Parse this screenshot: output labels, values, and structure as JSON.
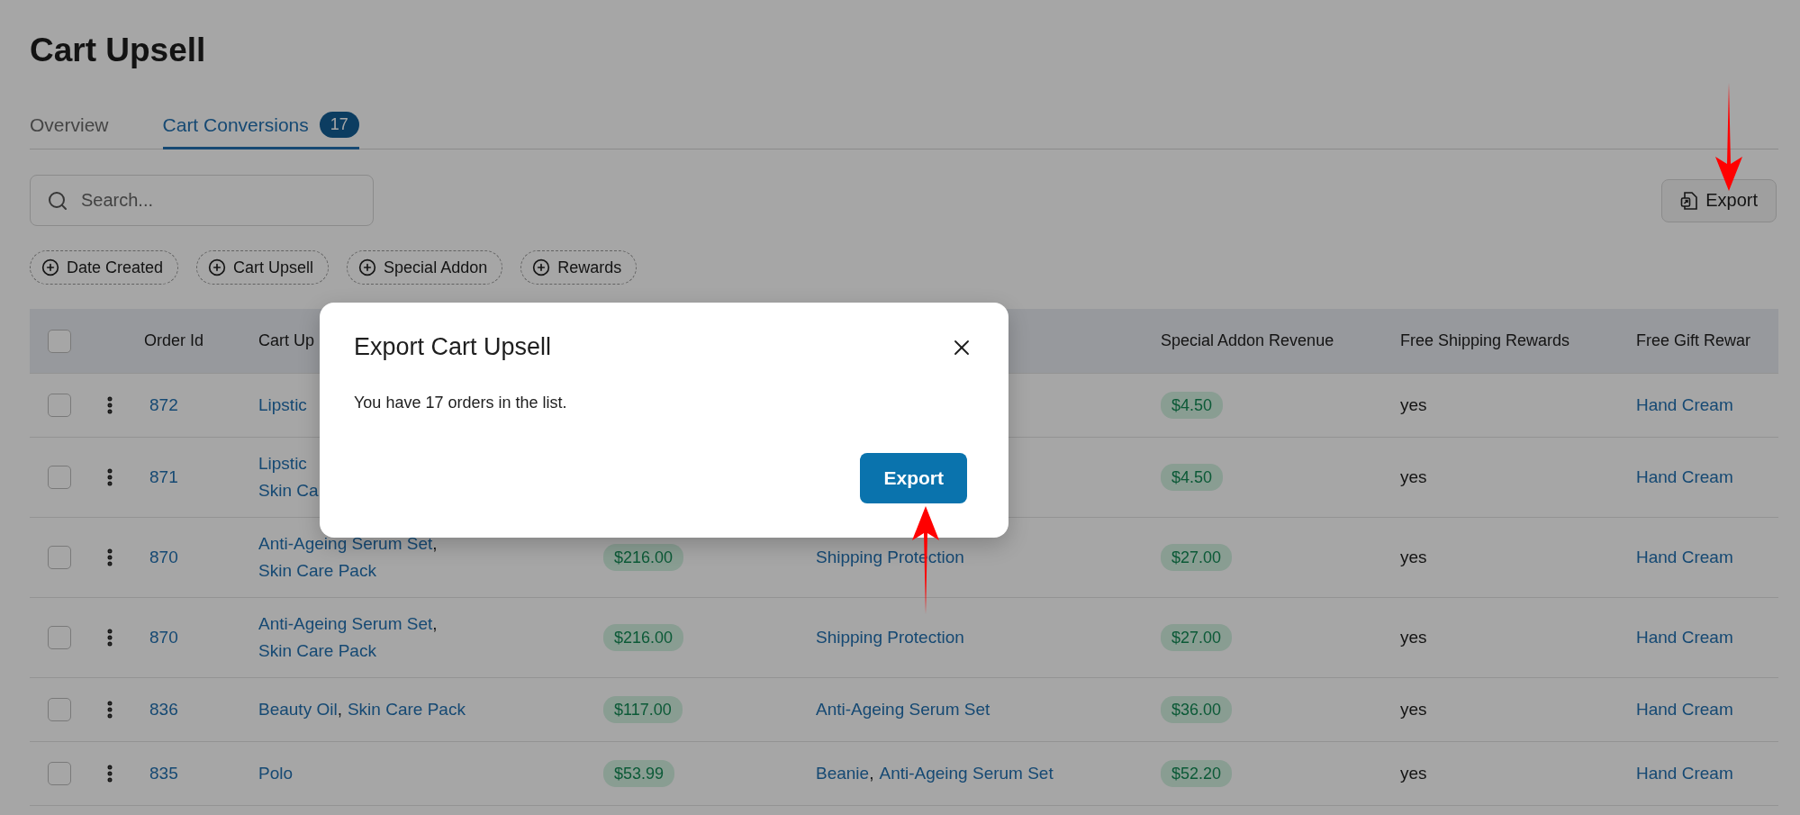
{
  "page": {
    "title": "Cart Upsell"
  },
  "tabs": [
    {
      "label": "Overview",
      "selected": false
    },
    {
      "label": "Cart Conversions",
      "selected": true,
      "badge": "17"
    }
  ],
  "search": {
    "placeholder": "Search..."
  },
  "export_button": {
    "label": "Export"
  },
  "filters": [
    {
      "label": "Date Created"
    },
    {
      "label": "Cart Upsell"
    },
    {
      "label": "Special Addon"
    },
    {
      "label": "Rewards"
    }
  ],
  "table": {
    "select_all_checked": false,
    "columns": [
      {
        "label": "Order Id"
      },
      {
        "label": "Cart Up"
      },
      {
        "label": "Special Addon Revenue"
      },
      {
        "label": "Free Shipping Rewards"
      },
      {
        "label": "Free Gift Rewar"
      }
    ],
    "rows": [
      {
        "checked": false,
        "order_id": "872",
        "cart_upsell": [
          [
            {
              "name": "Lipstic"
            }
          ]
        ],
        "special_addon_revenue": "$4.50",
        "free_shipping": "yes",
        "free_gift": "Hand Cream"
      },
      {
        "checked": false,
        "order_id": "871",
        "cart_upsell": [
          [
            {
              "name": "Lipstic"
            }
          ],
          [
            {
              "name": "Skin Ca"
            }
          ]
        ],
        "special_addon_revenue": "$4.50",
        "free_shipping": "yes",
        "free_gift": "Hand Cream"
      },
      {
        "checked": false,
        "order_id": "870",
        "cart_upsell": [
          [
            {
              "name": "Anti-Ageing Serum Set",
              "sep": ","
            }
          ],
          [
            {
              "name": "Skin Care Pack"
            }
          ]
        ],
        "cart_upsell_revenue": "$216.00",
        "special_addon": [
          [
            {
              "name": "Shipping Protection"
            }
          ]
        ],
        "special_addon_revenue": "$27.00",
        "free_shipping": "yes",
        "free_gift": "Hand Cream"
      },
      {
        "checked": false,
        "order_id": "870",
        "cart_upsell": [
          [
            {
              "name": "Anti-Ageing Serum Set",
              "sep": ","
            }
          ],
          [
            {
              "name": "Skin Care Pack"
            }
          ]
        ],
        "cart_upsell_revenue": "$216.00",
        "special_addon": [
          [
            {
              "name": "Shipping Protection"
            }
          ]
        ],
        "special_addon_revenue": "$27.00",
        "free_shipping": "yes",
        "free_gift": "Hand Cream"
      },
      {
        "checked": false,
        "order_id": "836",
        "cart_upsell": [
          [
            {
              "name": "Beauty Oil",
              "sep": ","
            },
            {
              "name": "Skin Care Pack"
            }
          ]
        ],
        "cart_upsell_revenue": "$117.00",
        "special_addon": [
          [
            {
              "name": "Anti-Ageing Serum Set"
            }
          ]
        ],
        "special_addon_revenue": "$36.00",
        "free_shipping": "yes",
        "free_gift": "Hand Cream"
      },
      {
        "checked": false,
        "order_id": "835",
        "cart_upsell": [
          [
            {
              "name": "Polo"
            }
          ]
        ],
        "cart_upsell_revenue": "$53.99",
        "special_addon": [
          [
            {
              "name": "Beanie",
              "sep": ","
            },
            {
              "name": "Anti-Ageing Serum Set"
            }
          ]
        ],
        "special_addon_revenue": "$52.20",
        "free_shipping": "yes",
        "free_gift": "Hand Cream"
      }
    ]
  },
  "dialog": {
    "title": "Export Cart Upsell",
    "message": "You have 17 orders in the list.",
    "button": "Export"
  }
}
